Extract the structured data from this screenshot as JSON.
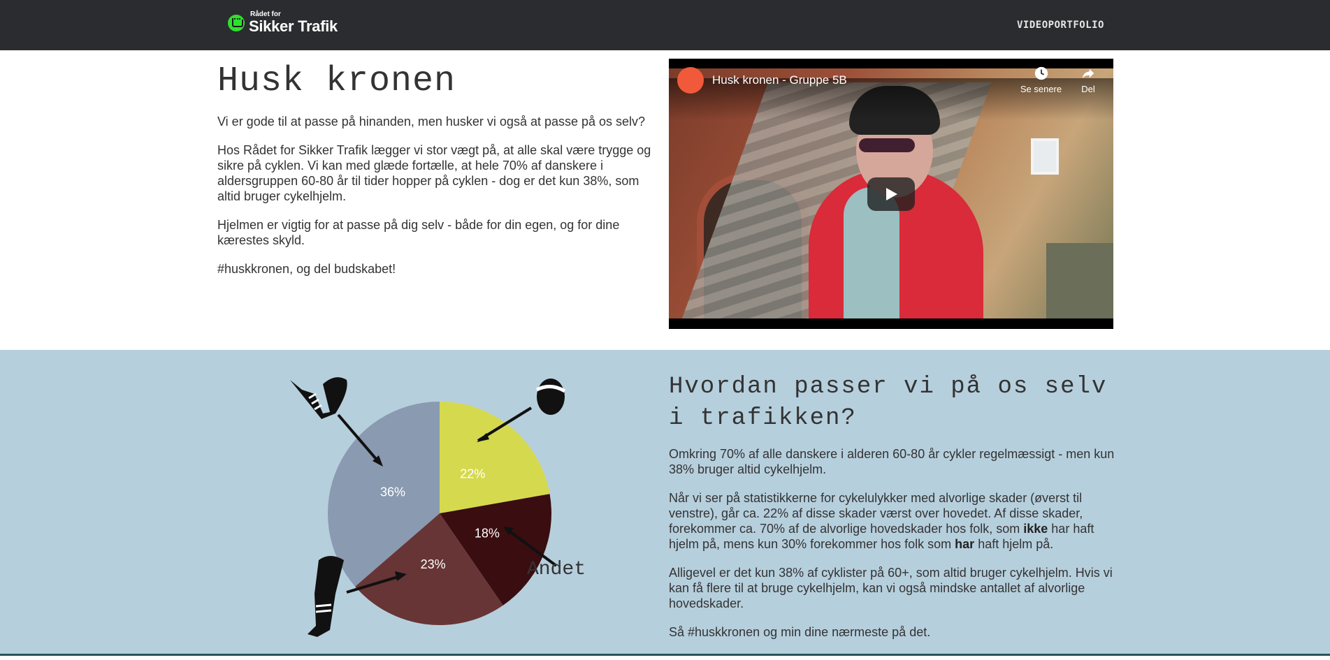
{
  "nav": {
    "logo_small": "Rådet for",
    "logo_big": "Sikker Trafik",
    "link": "VIDEOPORTFOLIO"
  },
  "section1": {
    "title": "Husk kronen",
    "paragraphs": [
      "Vi er gode til at passe på hinanden, men husker vi også at passe på os selv?",
      "Hos Rådet for Sikker Trafik lægger vi stor vægt på, at alle skal være trygge og sikre på cyklen. Vi kan med glæde fortælle, at hele 70% af danskere i aldersgruppen 60-80 år til tider hopper på cyklen - dog er det kun 38%, som altid bruger cykelhjelm.",
      "Hjelmen er vigtig for at passe på dig selv - både for din egen, og for dine kærestes skyld.",
      "#huskkronen, og del budskabet!"
    ]
  },
  "video": {
    "title": "Husk kronen - Gruppe 5B",
    "watch_later": "Se senere",
    "share": "Del"
  },
  "section2": {
    "title": "Hvordan passer vi på os selv i trafikken?",
    "p1": "Omkring 70% af alle danskere i alderen 60-80 år cykler regelmæssigt - men kun 38% bruger altid cykelhjelm.",
    "p2_a": "Når vi ser på statistikkerne for cykelulykker med alvorlige skader (øverst til venstre), går ca. 22% af disse skader værst over hovedet. Af disse skader, forekommer ca. 70% af de alvorlige hovedskader hos folk, som ",
    "p2_b": "ikke",
    "p2_c": " har haft hjelm på, mens kun 30% forekommer hos folk som ",
    "p2_d": "har",
    "p2_e": " haft hjelm på.",
    "p3": "Alligevel er det kun 38% af cyklister på 60+, som altid bruger cykelhjelm. Hvis vi kan få flere til at bruge cykelhjelm, kan vi også mindske antallet af alvorlige hovedskader.",
    "p4": "Så #huskkronen og min dine nærmeste på det."
  },
  "chart_data": {
    "type": "pie",
    "slices": [
      {
        "label": "22%",
        "value": 22,
        "color": "#d5d94e"
      },
      {
        "label": "18%",
        "value": 18,
        "color": "#3a0d10"
      },
      {
        "label": "23%",
        "value": 23,
        "color": "#673535"
      },
      {
        "label": "36%",
        "value": 36,
        "color": "#8a9ab0"
      }
    ],
    "annotations": [
      "Andet"
    ]
  },
  "colors": {
    "nav_bg": "#2b2c2f",
    "section2_bg": "#b6cfdd",
    "logo_green": "#2fe02f"
  }
}
